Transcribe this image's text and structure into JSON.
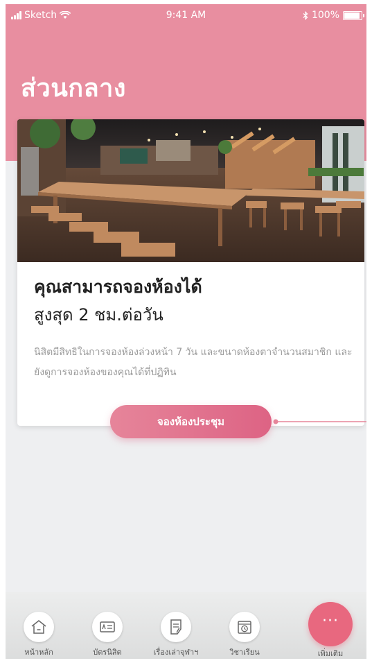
{
  "status_bar": {
    "carrier": "Sketch",
    "time": "9:41 AM",
    "battery": "100%",
    "battery_level": 1.0
  },
  "page": {
    "title": "ส่วนกลาง"
  },
  "card": {
    "headline": "คุณสามารถจองห้องได้",
    "subheadline": "สูงสุด 2 ชม.ต่อวัน",
    "description": "นิสิตมีสิทธิในการจองห้องล่วงหน้า 7 วัน และขนาดห้องตาจำนวนสมาชิก และยังดูการจองห้องของคุณได้ที่ปฏิทิน",
    "button_label": "จองห้องประชุม"
  },
  "tabs": [
    {
      "label": "หน้าหลัก",
      "icon": "home-icon"
    },
    {
      "label": "บัตรนิสิต",
      "icon": "id-card-icon"
    },
    {
      "label": "เรื่องเล่าจุฬาฯ",
      "icon": "document-edit-icon"
    },
    {
      "label": "วิชาเรียน",
      "icon": "calendar-clock-icon"
    },
    {
      "label": "เพิ่มเติม",
      "icon": "more-dots-icon"
    }
  ],
  "colors": {
    "header": "#e88ea0",
    "accent": "#e8687f",
    "button_start": "#e6859a",
    "button_end": "#dd6384"
  }
}
